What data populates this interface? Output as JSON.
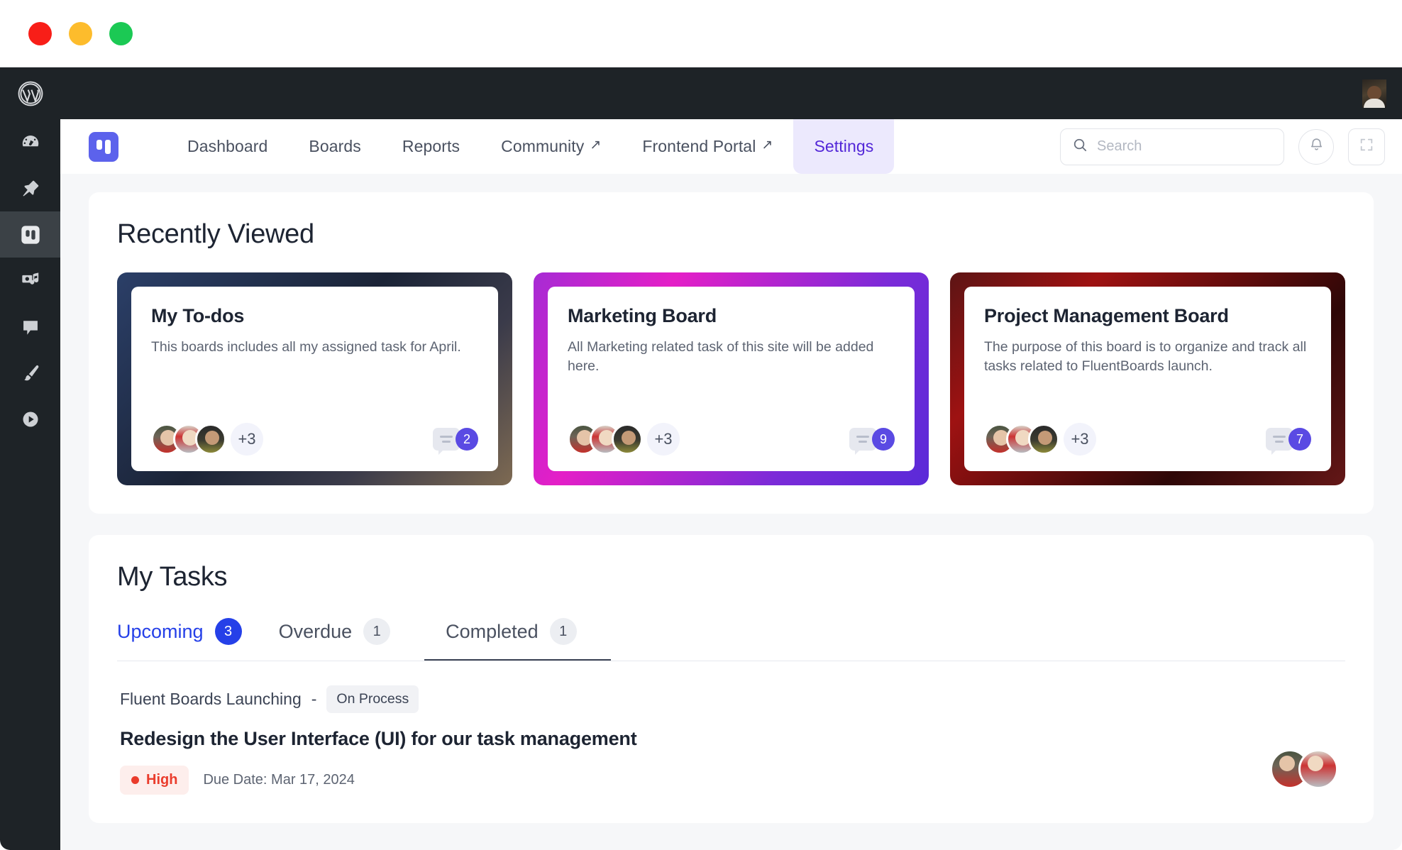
{
  "window": {
    "traffic_lights": [
      {
        "name": "close",
        "color": "#f81e18"
      },
      {
        "name": "minimize",
        "color": "#fdbc2c"
      },
      {
        "name": "zoom",
        "color": "#1bc954"
      }
    ]
  },
  "wp_sidebar": {
    "items": [
      {
        "icon": "wordpress-logo-icon",
        "label": "WordPress"
      },
      {
        "icon": "dashboard-gauge-icon",
        "label": "Dashboard"
      },
      {
        "icon": "pin-icon",
        "label": "Posts"
      },
      {
        "icon": "fluentboards-icon",
        "label": "FluentBoards",
        "active": true
      },
      {
        "icon": "media-icon",
        "label": "Media"
      },
      {
        "icon": "comment-icon",
        "label": "Comments"
      },
      {
        "icon": "paintbrush-icon",
        "label": "Appearance"
      },
      {
        "icon": "plugin-play-icon",
        "label": "Plugins"
      }
    ]
  },
  "adminbar": {
    "avatar": "user-avatar"
  },
  "appnav": {
    "logo": "fluentboards-logo",
    "links": [
      {
        "label": "Dashboard",
        "external": false,
        "active": false
      },
      {
        "label": "Boards",
        "external": false,
        "active": false
      },
      {
        "label": "Reports",
        "external": false,
        "active": false
      },
      {
        "label": "Community",
        "external": true,
        "active": false
      },
      {
        "label": "Frontend Portal",
        "external": true,
        "active": false
      },
      {
        "label": "Settings",
        "external": false,
        "active": true
      }
    ],
    "search": {
      "placeholder": "Search",
      "value": "",
      "icon": "search-icon"
    },
    "notification_icon": "bell-icon",
    "fullscreen_icon": "fullscreen-icon",
    "accent": "#5327d8",
    "accent_bg": "#ece9fd"
  },
  "recently_viewed": {
    "title": "Recently Viewed",
    "cards": [
      {
        "name": "My To-dos",
        "description": "This boards includes all my assigned task for April.",
        "extra_members": "+3",
        "comment_count": "2"
      },
      {
        "name": "Marketing Board",
        "description": "All Marketing related task of this site will be added here.",
        "extra_members": "+3",
        "comment_count": "9"
      },
      {
        "name": "Project Management Board",
        "description": "The purpose of this board is to organize and track all tasks related to FluentBoards launch.",
        "extra_members": "+3",
        "comment_count": "7"
      }
    ]
  },
  "my_tasks": {
    "title": "My Tasks",
    "tabs": [
      {
        "label": "Upcoming",
        "count": "3",
        "state": "active"
      },
      {
        "label": "Overdue",
        "count": "1",
        "state": "default"
      },
      {
        "label": "Completed",
        "count": "1",
        "state": "hovered"
      }
    ],
    "rows": [
      {
        "board": "Fluent Boards Launching",
        "separator": "-",
        "stage": "On Process",
        "title": "Redesign the User Interface (UI) for our task management",
        "priority": "High",
        "priority_color": "#ea3c2c",
        "due_date": "Due Date: Mar 17, 2024"
      }
    ]
  }
}
